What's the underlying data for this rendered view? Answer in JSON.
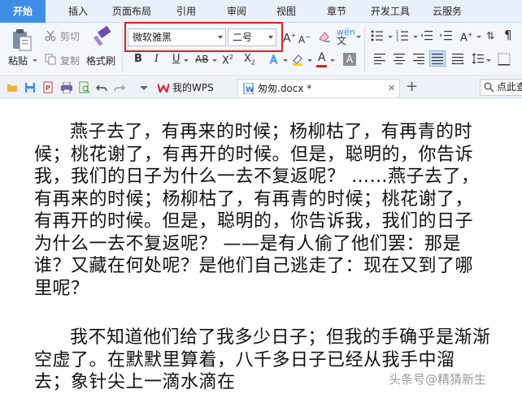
{
  "menu": {
    "tabs": [
      {
        "label": "开始",
        "active": true
      },
      {
        "label": "插入"
      },
      {
        "label": "页面布局"
      },
      {
        "label": "引用"
      },
      {
        "label": "审阅"
      },
      {
        "label": "视图"
      },
      {
        "label": "章节"
      },
      {
        "label": "开发工具"
      },
      {
        "label": "云服务"
      }
    ]
  },
  "ribbon": {
    "cut_label": "剪切",
    "paste_label": "粘贴",
    "copy_label": "复制",
    "format_painter_label": "格式刷",
    "font_name": "微软雅黑",
    "font_size": "二号"
  },
  "tabbar": {
    "tabs": [
      {
        "label": "我的WPS"
      },
      {
        "label": "匆匆.docx *",
        "active": true
      }
    ],
    "search_placeholder": "点此查"
  },
  "document": {
    "paragraphs": [
      "燕子去了，有再来的时候；杨柳枯了，有再青的时候；桃花谢了，有再开的时候。但是，聪明的，你告诉我，我们的日子为什么一去不复返呢？ ……燕子去了，有再来的时候；杨柳枯了，有再青的时候；桃花谢了，有再开的时候。但是，聪明的，你告诉我，我们的日子为什么一去不复返呢？ ——是有人偷了他们罢：那是谁？又藏在何处呢？是他们自己逃走了：现在又到了哪里呢？",
      "我不知道他们给了我多少日子；但我的手确乎是渐渐空虚了。在默默里算着，八千多日子已经从我手中溜去；象针尖上一滴水滴在"
    ]
  },
  "watermark": "头条号@精猜新生",
  "colors": {
    "accent": "#3f8ee6",
    "highlight_frame": "#e02020"
  }
}
